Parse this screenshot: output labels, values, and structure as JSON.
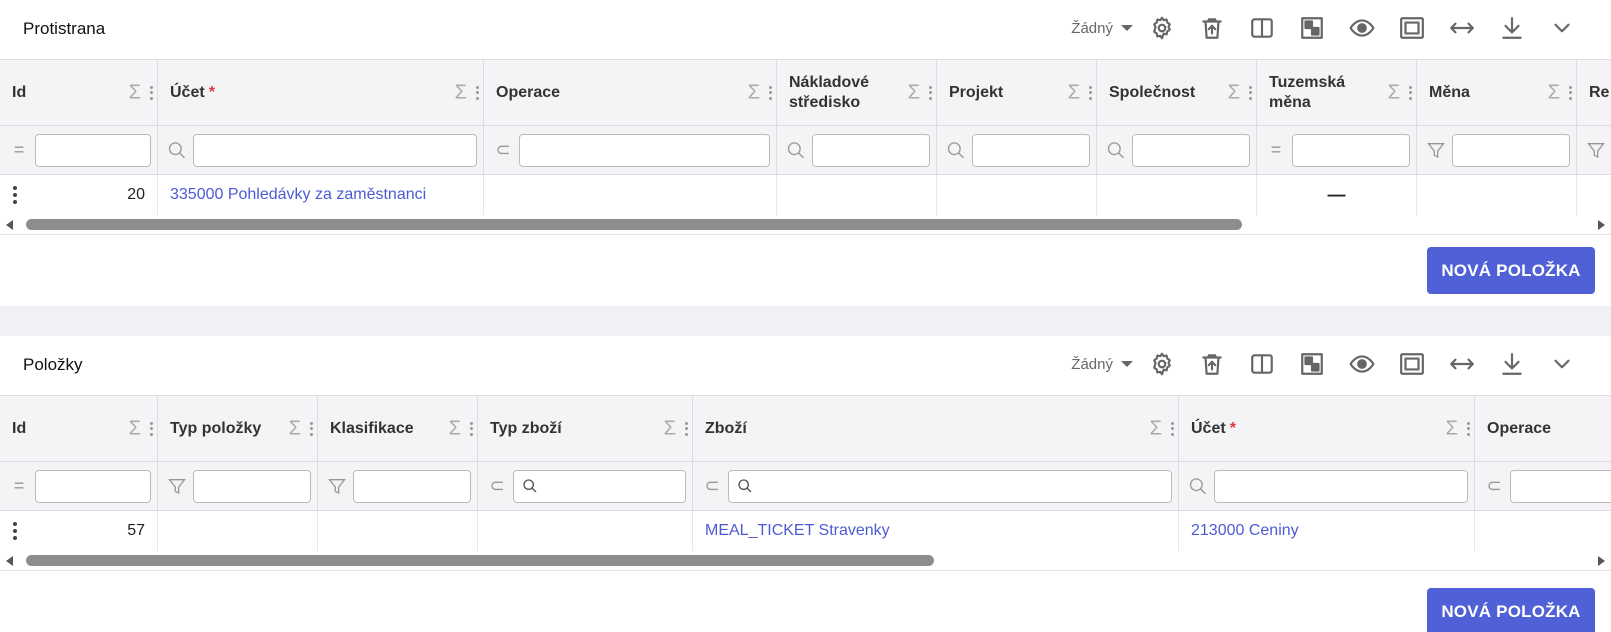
{
  "panels": [
    {
      "title": "Protistrana",
      "preset": "Žádný",
      "columns": [
        {
          "label": "Id",
          "required": false,
          "filter": "eq"
        },
        {
          "label": "Účet",
          "required": true,
          "filter": "search"
        },
        {
          "label": "Operace",
          "required": false,
          "filter": "subset"
        },
        {
          "label": "Nákladové středisko",
          "required": false,
          "filter": "search"
        },
        {
          "label": "Projekt",
          "required": false,
          "filter": "search"
        },
        {
          "label": "Společnost",
          "required": false,
          "filter": "search"
        },
        {
          "label": "Tuzemská měna",
          "required": false,
          "filter": "eq"
        },
        {
          "label": "Měna",
          "required": false,
          "filter": "funnel"
        },
        {
          "label": "Re",
          "required": false,
          "filter": "funnel"
        }
      ],
      "row": [
        "20",
        "335000 Pohledávky za zaměstnanci",
        "",
        "",
        "",
        "",
        "—",
        "",
        ""
      ],
      "new_button": "NOVÁ POLOŽKA"
    },
    {
      "title": "Položky",
      "preset": "Žádný",
      "columns": [
        {
          "label": "Id",
          "required": false,
          "filter": "eq"
        },
        {
          "label": "Typ položky",
          "required": false,
          "filter": "funnel"
        },
        {
          "label": "Klasifikace",
          "required": false,
          "filter": "funnel"
        },
        {
          "label": "Typ zboží",
          "required": false,
          "filter": "subset"
        },
        {
          "label": "Zboží",
          "required": false,
          "filter": "subset"
        },
        {
          "label": "Účet",
          "required": true,
          "filter": "search"
        },
        {
          "label": "Operace",
          "required": false,
          "filter": "subset"
        }
      ],
      "row": [
        "57",
        "",
        "",
        "",
        "MEAL_TICKET Stravenky",
        "213000 Ceniny",
        ""
      ],
      "new_button": "NOVÁ POLOŽKA"
    }
  ],
  "toolbar_icons": [
    "gear-icon",
    "delete-icon",
    "split-view-icon",
    "layout-icon",
    "visibility-icon",
    "fit-icon",
    "resize-icon",
    "download-icon",
    "chevron-down-icon"
  ],
  "colors": {
    "accent": "#5060d6",
    "link": "#4c5bd4",
    "required": "#e0383e"
  }
}
